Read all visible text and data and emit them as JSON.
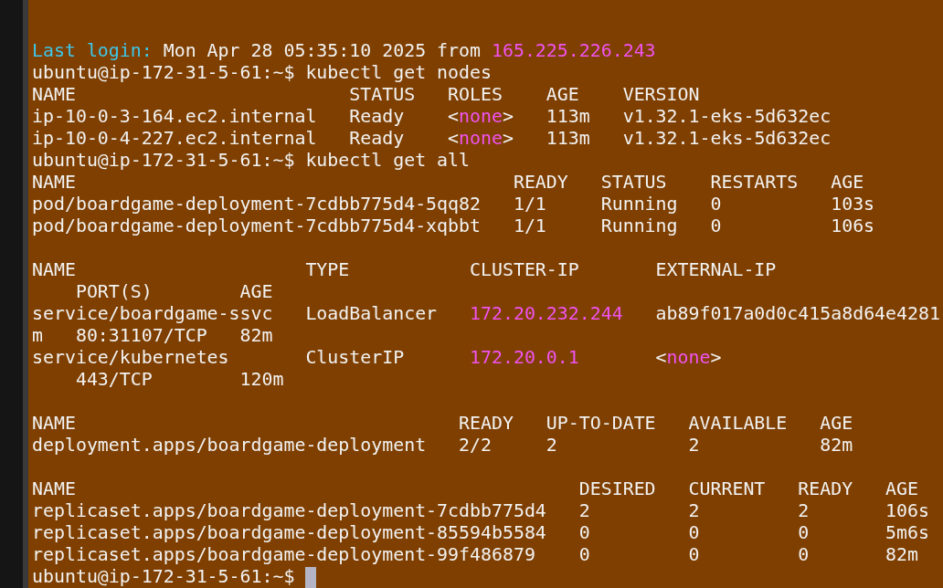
{
  "terminal": {
    "blocks": [
      [
        {
          "segments": [
            {
              "kind": "label",
              "text": "Last login:"
            },
            {
              "kind": "plain",
              "text": " Mon Apr 28 05:35:10 2025 from "
            },
            {
              "kind": "address",
              "text": "165.225.226.243"
            }
          ]
        },
        {
          "segments": [
            {
              "kind": "plain",
              "text": "ubuntu@ip-172-31-5-61:~$ kubectl get nodes"
            }
          ]
        },
        {
          "segments": [
            {
              "kind": "plain",
              "text": "NAME                         STATUS   ROLES    AGE    VERSION"
            }
          ]
        },
        {
          "segments": [
            {
              "kind": "plain",
              "text": "ip-10-0-3-164.ec2.internal   Ready    <"
            },
            {
              "kind": "address",
              "text": "none"
            },
            {
              "kind": "plain",
              "text": ">   113m   v1.32.1-eks-5d632ec"
            }
          ]
        },
        {
          "segments": [
            {
              "kind": "plain",
              "text": "ip-10-0-4-227.ec2.internal   Ready    <"
            },
            {
              "kind": "address",
              "text": "none"
            },
            {
              "kind": "plain",
              "text": ">   113m   v1.32.1-eks-5d632ec"
            }
          ]
        },
        {
          "segments": [
            {
              "kind": "plain",
              "text": "ubuntu@ip-172-31-5-61:~$ kubectl get all"
            }
          ]
        },
        {
          "segments": [
            {
              "kind": "plain",
              "text": "NAME                                        READY   STATUS    RESTARTS   AGE"
            }
          ]
        },
        {
          "segments": [
            {
              "kind": "plain",
              "text": "pod/boardgame-deployment-7cdbb775d4-5qq82   1/1     Running   0          103s"
            }
          ]
        },
        {
          "segments": [
            {
              "kind": "plain",
              "text": "pod/boardgame-deployment-7cdbb775d4-xqbbt   1/1     Running   0          106s"
            }
          ]
        }
      ],
      [
        {
          "segments": [
            {
              "kind": "plain",
              "text": "NAME                     TYPE           CLUSTER-IP       EXTERNAL-IP"
            }
          ]
        },
        {
          "segments": [
            {
              "kind": "plain",
              "text": "    PORT(S)        AGE"
            }
          ]
        },
        {
          "segments": [
            {
              "kind": "plain",
              "text": "service/boardgame-ssvc   LoadBalancer   "
            },
            {
              "kind": "address",
              "text": "172.20.232.244"
            },
            {
              "kind": "plain",
              "text": "   ab89f017a0d0c415a8d64e4281"
            }
          ]
        },
        {
          "segments": [
            {
              "kind": "plain",
              "text": "m   80:31107/TCP   82m"
            }
          ]
        },
        {
          "segments": [
            {
              "kind": "plain",
              "text": "service/kubernetes       ClusterIP      "
            },
            {
              "kind": "address",
              "text": "172.20.0.1"
            },
            {
              "kind": "plain",
              "text": "       <"
            },
            {
              "kind": "address",
              "text": "none"
            },
            {
              "kind": "plain",
              "text": ">"
            }
          ]
        },
        {
          "segments": [
            {
              "kind": "plain",
              "text": "    443/TCP        120m"
            }
          ]
        }
      ],
      [
        {
          "segments": [
            {
              "kind": "plain",
              "text": "NAME                                   READY   UP-TO-DATE   AVAILABLE   AGE"
            }
          ]
        },
        {
          "segments": [
            {
              "kind": "plain",
              "text": "deployment.apps/boardgame-deployment   2/2     2            2           82m"
            }
          ]
        }
      ],
      [
        {
          "segments": [
            {
              "kind": "plain",
              "text": "NAME                                              DESIRED   CURRENT   READY   AGE"
            }
          ]
        },
        {
          "segments": [
            {
              "kind": "plain",
              "text": "replicaset.apps/boardgame-deployment-7cdbb775d4   2         2         2       106s"
            }
          ]
        },
        {
          "segments": [
            {
              "kind": "plain",
              "text": "replicaset.apps/boardgame-deployment-85594b5584   0         0         0       5m6s"
            }
          ]
        },
        {
          "segments": [
            {
              "kind": "plain",
              "text": "replicaset.apps/boardgame-deployment-99f486879    0         0         0       82m"
            }
          ]
        },
        {
          "segments": [
            {
              "kind": "plain",
              "text": "ubuntu@ip-172-31-5-61:~$ "
            }
          ],
          "cursor": true
        }
      ]
    ]
  }
}
